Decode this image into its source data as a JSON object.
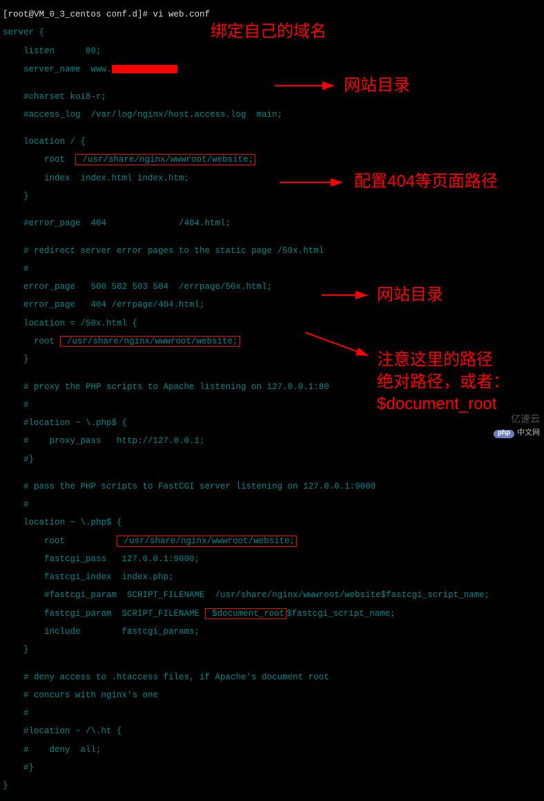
{
  "prompt": {
    "user_host": "[root@VM_0_3_centos conf.d]# ",
    "command": "vi web.conf"
  },
  "config": {
    "server_open": "server {",
    "listen": "    listen      80;",
    "server_name_pre": "    server_name  www.",
    "charset": "    #charset koi8-r;",
    "access_log": "    #access_log  /var/log/nginx/host.access.log  main;",
    "location_root_open": "    location / {",
    "root_pre": "        root  ",
    "root_path1": " /usr/share/nginx/wwwroot/website;",
    "index_line": "        index  index.html index.htm;",
    "close_brace": "    }",
    "error_page_comment": "    #error_page  404              /404.html;",
    "redirect_comment": "    # redirect server error pages to the static page /50x.html",
    "hash": "    #",
    "error_page_500": "    error_page   500 502 503 504  /errpage/50x.html;",
    "error_page_404": "    error_page   404 /errpage/404.html;",
    "location_50x": "    location = /50x.html {",
    "root_pre2": "      root ",
    "root_path2": " /usr/share/nginx/wwwroot/website;",
    "proxy_comment": "    # proxy the PHP scripts to Apache listening on 127.0.0.1:80",
    "location_php_proxy": "    #location ~ \\.php$ {",
    "proxy_pass": "    #    proxy_pass   http://127.0.0.1;",
    "close_comment": "    #}",
    "fastcgi_comment": "    # pass the PHP scripts to FastCGI server listening on 127.0.0.1:9000",
    "location_php": "    location ~ \\.php$ {",
    "root_pre3": "        root          ",
    "root_path3": " /usr/share/nginx/wwwroot/website;",
    "fastcgi_pass": "        fastcgi_pass   127.0.0.1:9000;",
    "fastcgi_index": "        fastcgi_index  index.php;",
    "fastcgi_param_comment": "        #fastcgi_param  SCRIPT_FILENAME  /usr/share/nginx/wwwroot/website$fastcgi_script_name;",
    "fastcgi_param_pre": "        fastcgi_param  SCRIPT_FILENAME ",
    "doc_root": " $document_root",
    "fastcgi_param_post": "$fastcgi_script_name;",
    "include": "        include        fastcgi_params;",
    "deny_comment1": "    # deny access to .htaccess files, if Apache's document root",
    "deny_comment2": "    # concurs with nginx's one",
    "location_ht": "    #location ~ /\\.ht {",
    "deny_all": "    #    deny  all;",
    "final_close": "}",
    "blank": ""
  },
  "annotations": {
    "a1": "绑定自己的域名",
    "a2": "网站目录",
    "a3": "配置404等页面路径",
    "a4": "网站目录",
    "a5_l1": "注意这里的路径",
    "a5_l2": "绝对路径，或者：",
    "a5_l3": "$document_root"
  },
  "watermark": {
    "php": "php",
    "cnnet": "中文网",
    "yi": "亿速云"
  }
}
